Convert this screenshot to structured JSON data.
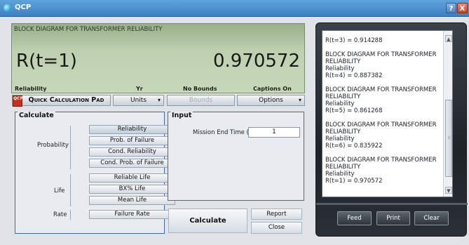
{
  "window": {
    "title": "QCP",
    "help_label": "?",
    "close_label": "X",
    "icon": "qcp-app-icon"
  },
  "display": {
    "title": "BLOCK DIAGRAM FOR TRANSFORMER RELIABILITY",
    "expression": "R(t=1)",
    "value": "0.970572",
    "footer": {
      "metric": "Reliability",
      "unit": "Yr",
      "bounds": "No Bounds",
      "captions": "Captions On"
    }
  },
  "toolbar": {
    "qcp_badge": "QCP",
    "pad_label": "Quick Calculation Pad",
    "units_label": "Units",
    "bounds_label": "Bounds",
    "options_label": "Options"
  },
  "calculate": {
    "title": "Calculate",
    "probability_label": "Probability",
    "life_label": "Life",
    "rate_label": "Rate",
    "probability_options": [
      "Reliability",
      "Prob. of Failure",
      "Cond. Reliability",
      "Cond. Prob. of Failure"
    ],
    "life_options": [
      "Reliable Life",
      "BX% Life",
      "Mean Life"
    ],
    "rate_options": [
      "Failure Rate"
    ],
    "selected": "Reliability"
  },
  "input": {
    "title": "Input",
    "mission_label": "Mission End Time (Yr)",
    "mission_value": "1"
  },
  "actions": {
    "calculate_label": "Calculate",
    "report_label": "Report",
    "close_label": "Close"
  },
  "tape": {
    "text": "R(t=3) = 0.914288\n\nBLOCK DIAGRAM FOR TRANSFORMER\nRELIABILITY\nReliability\nR(t=4) = 0.887382\n\nBLOCK DIAGRAM FOR TRANSFORMER\nRELIABILITY\nReliability\nR(t=5) = 0.861268\n\nBLOCK DIAGRAM FOR TRANSFORMER\nRELIABILITY\nReliability\nR(t=6) = 0.835922\n\nBLOCK DIAGRAM FOR TRANSFORMER\nRELIABILITY\nReliability\nR(t=1) = 0.970572",
    "feed_label": "Feed",
    "print_label": "Print",
    "clear_label": "Clear"
  },
  "colors": {
    "titlebar": "#4a8fd0",
    "lcd": "#bfd0b1",
    "group_border": "#3f6aa5",
    "led": "#3fcb35",
    "close": "#d2462a"
  }
}
